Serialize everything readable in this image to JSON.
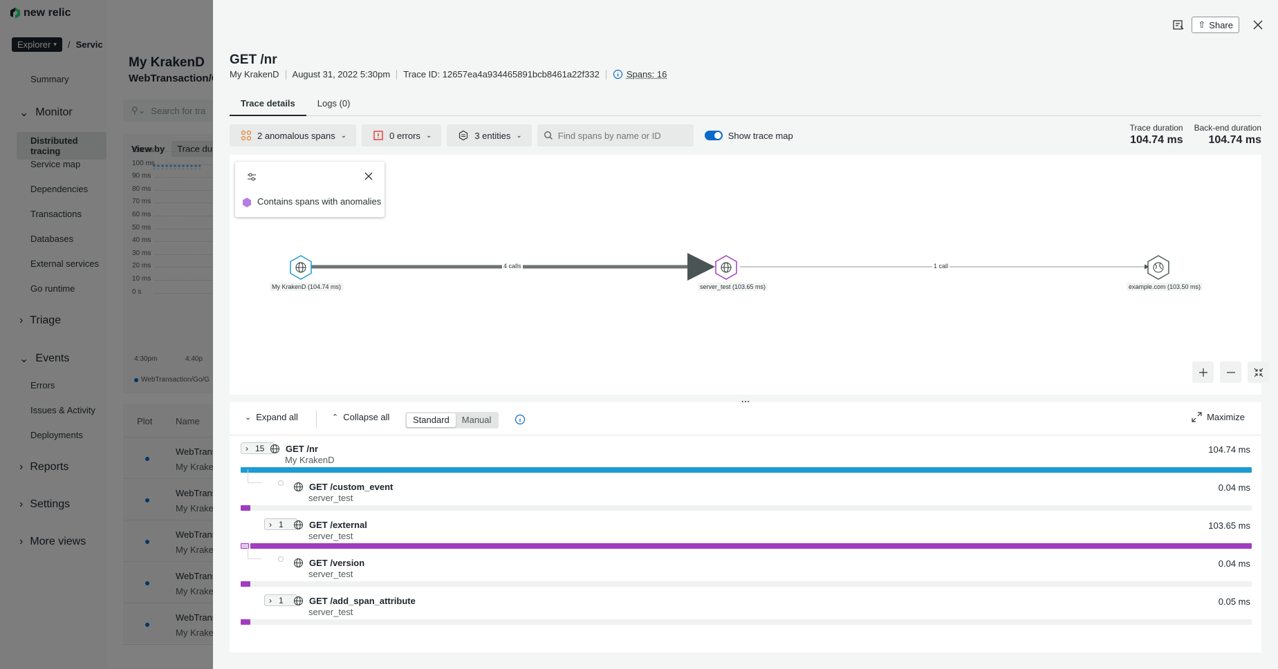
{
  "app": {
    "brand": "new relic"
  },
  "background": {
    "crumbs": {
      "explorer": "Explorer",
      "sep": "/",
      "service": "Servic"
    },
    "nav": {
      "summary": "Summary",
      "monitor": "Monitor",
      "distributed_tracing": "Distributed tracing",
      "service_map": "Service map",
      "dependencies": "Dependencies",
      "transactions": "Transactions",
      "databases": "Databases",
      "external_services": "External services",
      "go_runtime": "Go runtime",
      "triage": "Triage",
      "events": "Events",
      "errors": "Errors",
      "issues": "Issues & Activity",
      "deployments": "Deployments",
      "reports": "Reports",
      "settings": "Settings",
      "more_views": "More views"
    },
    "page_title": "My KrakenD",
    "page_subtitle": "WebTransaction/G",
    "search_placeholder": "Search for tra",
    "view_by_label": "View by",
    "view_by_value": "Trace dur",
    "y_ticks": [
      "110 ms",
      "100 ms",
      "90 ms",
      "80 ms",
      "70 ms",
      "60 ms",
      "50 ms",
      "40 ms",
      "30 ms",
      "20 ms",
      "10 ms",
      "0 s"
    ],
    "x_ticks": [
      "4:30pm",
      "4:40p"
    ],
    "legend": "WebTransaction/Go/G",
    "table_headers": {
      "plot": "Plot",
      "name": "Name"
    },
    "rows": [
      {
        "n1": "WebTrans",
        "n2": "My Kraken"
      },
      {
        "n1": "WebTrans",
        "n2": "My Kraken"
      },
      {
        "n1": "WebTrans",
        "n2": "My Kraken"
      },
      {
        "n1": "WebTrans",
        "n2": "My Kraken"
      },
      {
        "n1": "WebTrans",
        "n2": "My Kraken"
      }
    ]
  },
  "panel": {
    "share_label": "Share",
    "title": "GET /nr",
    "meta": {
      "entity": "My KrakenD",
      "date": "August 31, 2022 5:30pm",
      "trace_id": "Trace ID: 12657ea4a934465891bcb8461a22f332",
      "spans": "Spans: 16"
    },
    "tabs": [
      {
        "label": "Trace details"
      },
      {
        "label": "Logs (0)"
      }
    ],
    "filters": {
      "anomalous": "2 anomalous spans",
      "errors": "0 errors",
      "entities": "3 entities",
      "search_placeholder": "Find spans by name or ID",
      "show_map": "Show trace map"
    },
    "durations": {
      "trace_label": "Trace duration",
      "trace_value": "104.74 ms",
      "backend_label": "Back-end duration",
      "backend_value": "104.74 ms"
    },
    "map": {
      "legend_text": "Contains spans with anomalies",
      "nodes": [
        {
          "label": "My KrakenD (104.74 ms)"
        },
        {
          "label": "server_test (103.65 ms)"
        },
        {
          "label": "example.com (103.50 ms)"
        }
      ],
      "edges": [
        "4 calls",
        "1 call"
      ],
      "colors": {
        "root": "#1c9bd4",
        "anomaly": "#a13cc1",
        "external": "#505959"
      }
    },
    "waterfall": {
      "expand_all": "Expand all",
      "collapse_all": "Collapse all",
      "standard": "Standard",
      "manual": "Manual",
      "maximize": "Maximize",
      "spans": [
        {
          "count": "15",
          "name": "GET /nr",
          "entity": "My KrakenD",
          "duration": "104.74 ms"
        },
        {
          "count": "",
          "name": "GET /custom_event",
          "entity": "server_test",
          "duration": "0.04 ms"
        },
        {
          "count": "1",
          "name": "GET /external",
          "entity": "server_test",
          "duration": "103.65 ms"
        },
        {
          "count": "",
          "name": "GET /version",
          "entity": "server_test",
          "duration": "0.04 ms"
        },
        {
          "count": "1",
          "name": "GET /add_span_attribute",
          "entity": "server_test",
          "duration": "0.05 ms"
        }
      ]
    }
  }
}
